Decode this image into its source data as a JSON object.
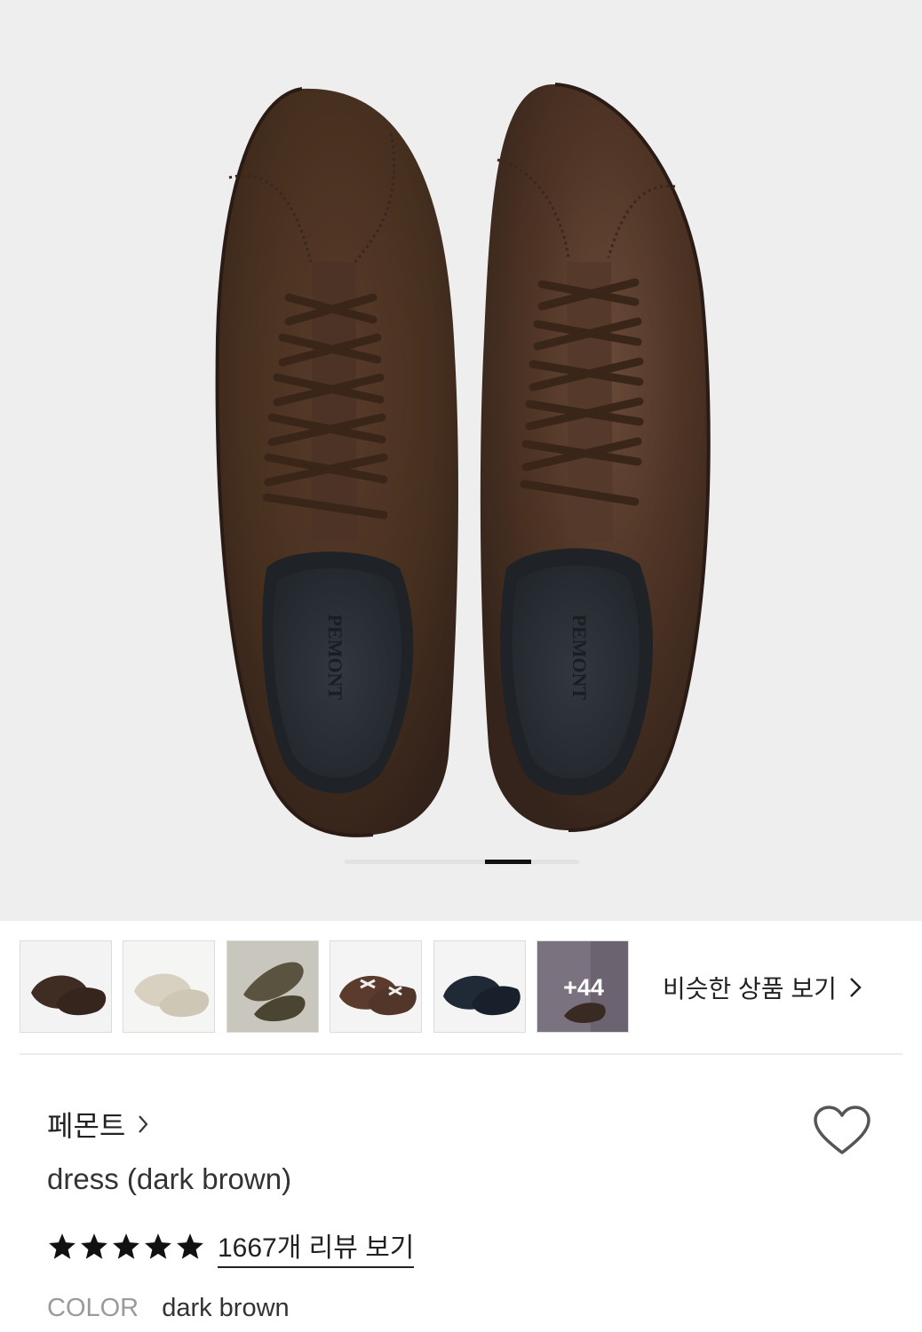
{
  "gallery": {
    "image_name": "dark-brown-suede-sneakers-photo",
    "slide_count": 5,
    "active_slide": 4,
    "thumbnails": [
      {
        "name": "thumbnail-dark-brown",
        "color": "#3f2c22"
      },
      {
        "name": "thumbnail-beige",
        "color": "#d8d1c2"
      },
      {
        "name": "thumbnail-olive",
        "color": "#5a5340"
      },
      {
        "name": "thumbnail-brown-white-laces",
        "color": "#5a3b2c"
      },
      {
        "name": "thumbnail-navy",
        "color": "#1f2a36"
      },
      {
        "name": "thumbnail-more",
        "color": "#5c5560"
      }
    ],
    "more_label": "+44",
    "similar_label": "비슷한 상품 보기"
  },
  "product": {
    "brand": "페몬트",
    "title": "dress (dark brown)",
    "rating_stars": 5,
    "reviews_label": "1667개 리뷰 보기",
    "color_label": "COLOR",
    "color_value": "dark brown",
    "insole_logo": "PEMONT"
  },
  "colors": {
    "accent": "#111111",
    "suede": "#4a3124",
    "insole": "#2b3036"
  }
}
